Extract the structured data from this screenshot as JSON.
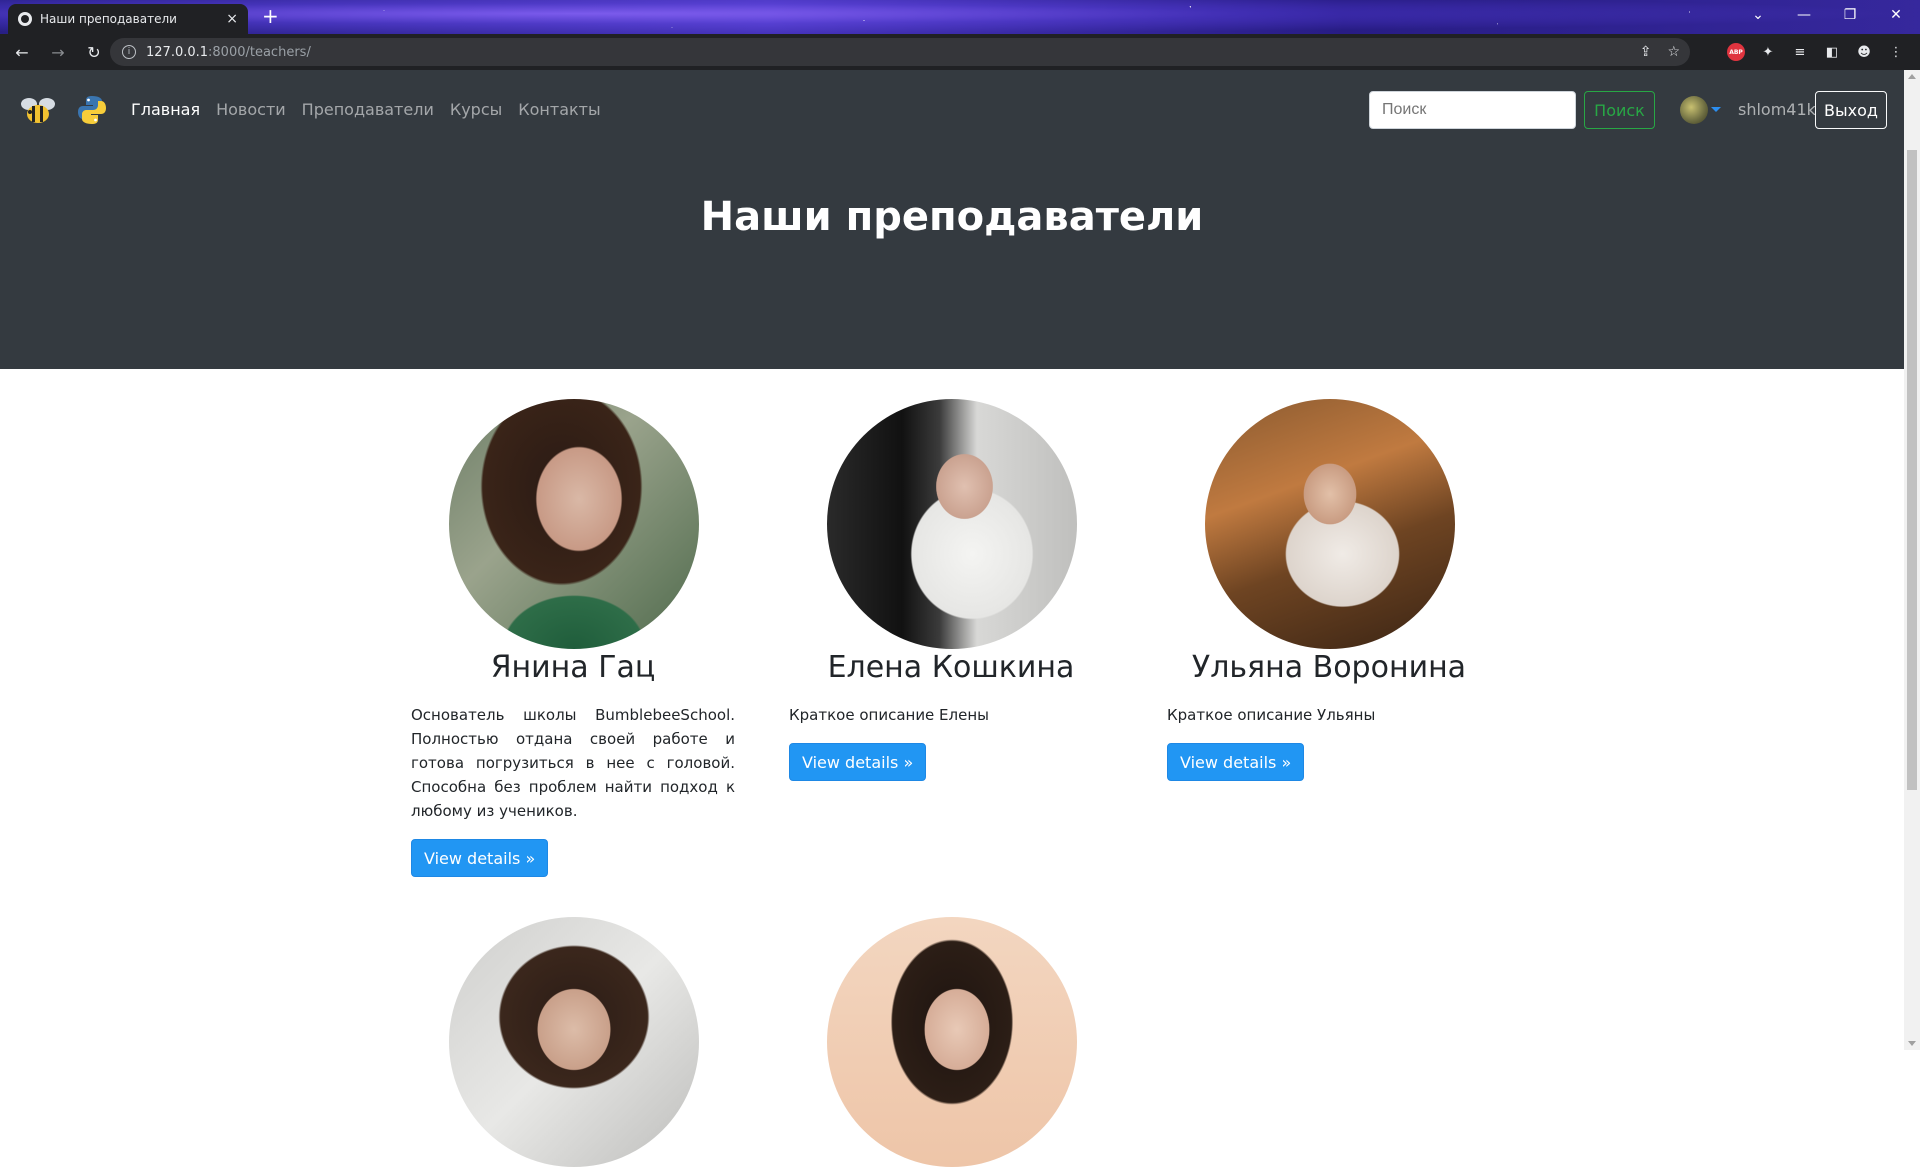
{
  "browser": {
    "tab_title": "Наши преподаватели",
    "tab_close": "×",
    "new_tab": "+",
    "url_host": "127.0.0.1",
    "url_path": ":8000/teachers/",
    "back_icon": "←",
    "forward_icon": "→",
    "reload_icon": "↻",
    "window_minimize": "—",
    "window_restore": "❐",
    "window_close": "✕",
    "tab_search": "⌄",
    "abp_label": "ABP"
  },
  "site": {
    "nav": {
      "items": [
        {
          "label": "Главная",
          "active": true
        },
        {
          "label": "Новости",
          "active": false
        },
        {
          "label": "Преподаватели",
          "active": false
        },
        {
          "label": "Курсы",
          "active": false
        },
        {
          "label": "Контакты",
          "active": false
        }
      ],
      "search_placeholder": "Поиск",
      "search_button": "Поиск",
      "username": "shlom41k",
      "logout": "Выход"
    },
    "hero_title": "Наши преподаватели",
    "teachers": [
      {
        "name": "Янина Гац",
        "description": "Основатель школы BumblebeeSchool. Полностью отдана своей работе и готова погрузиться в нее с головой. Способна без проблем найти подход к любому из учеников.",
        "button": "View details »"
      },
      {
        "name": "Елена Кошкина",
        "description": "Краткое описание Елены",
        "button": "View details »"
      },
      {
        "name": "Ульяна Воронина",
        "description": "Краткое описание Ульяны",
        "button": "View details »"
      }
    ]
  }
}
